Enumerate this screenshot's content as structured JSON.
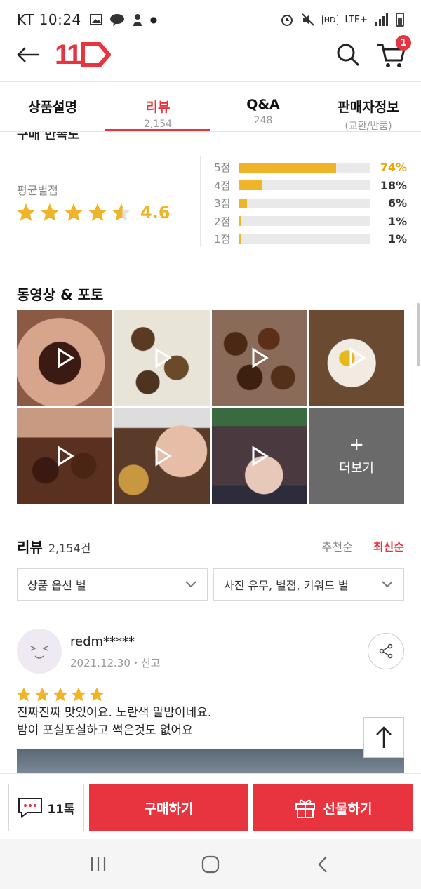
{
  "status_bar": {
    "carrier_time": "KT 10:24",
    "network": "LTE+",
    "hd": "HD"
  },
  "header": {
    "logo": "11",
    "cart_count": "1"
  },
  "tabs": [
    {
      "label": "상품설명",
      "sub": ""
    },
    {
      "label": "리뷰",
      "sub": "2,154"
    },
    {
      "label": "Q&A",
      "sub": "248"
    },
    {
      "label": "판매자정보",
      "sub": "(교환/반품)"
    }
  ],
  "rating": {
    "cut_title": "구매 만족도",
    "avg_label": "평균별점",
    "avg_score": "4.6",
    "avg_value": 4.6,
    "distribution": [
      {
        "label": "5점",
        "pct": "74%",
        "value": 0.74
      },
      {
        "label": "4점",
        "pct": "18%",
        "value": 0.18
      },
      {
        "label": "3점",
        "pct": "6%",
        "value": 0.06
      },
      {
        "label": "2점",
        "pct": "1%",
        "value": 0.01
      },
      {
        "label": "1점",
        "pct": "1%",
        "value": 0.01
      }
    ]
  },
  "media": {
    "title": "동영상 & 포토",
    "more_label": "더보기",
    "more_plus": "+"
  },
  "reviews": {
    "title": "리뷰",
    "count": "2,154건",
    "sort_recommended": "추천순",
    "sort_latest": "최신순",
    "filter_option": "상품 옵션 별",
    "filter_photo": "사진 유무, 별점, 키워드 별",
    "item": {
      "user": "redm*****",
      "meta": "2021.12.30・신고",
      "rating": 5,
      "line1": "진짜진짜 맛있어요. 노란색 알밤이네요.",
      "line2": "밤이 포실포실하고 썩은것도 없어요"
    }
  },
  "bottom": {
    "talk_label": "11톡",
    "buy_label": "구매하기",
    "gift_label": "선물하기"
  },
  "colors": {
    "brand": "#e8343f",
    "star": "#f0b429"
  }
}
